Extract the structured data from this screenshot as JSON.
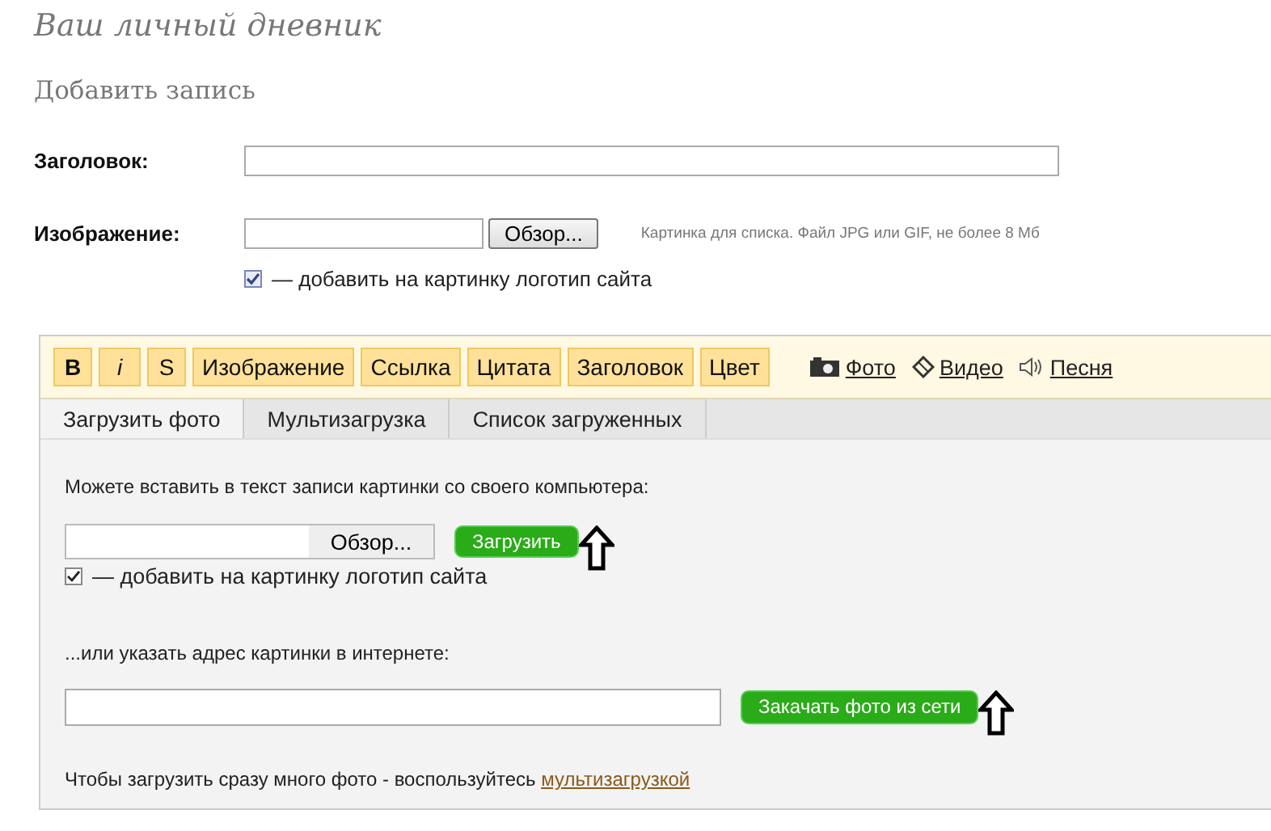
{
  "page_title": "Ваш личный дневник",
  "section_title": "Добавить запись",
  "form": {
    "title_label": "Заголовок:",
    "image_label": "Изображение:",
    "browse_button": "Обзор...",
    "image_hint": "Картинка для списка. Файл JPG или GIF, не более 8 Мб",
    "logo_checkbox": {
      "label": "— добавить на картинку логотип сайта",
      "checked": true
    }
  },
  "editor": {
    "format_buttons": [
      {
        "label": "B",
        "kind": "bold"
      },
      {
        "label": "i",
        "kind": "italic"
      },
      {
        "label": "S",
        "kind": "plain"
      },
      {
        "label": "Изображение",
        "kind": "plain"
      },
      {
        "label": "Ссылка",
        "kind": "plain"
      },
      {
        "label": "Цитата",
        "kind": "plain"
      },
      {
        "label": "Заголовок",
        "kind": "plain"
      },
      {
        "label": "Цвет",
        "kind": "plain"
      }
    ],
    "media_links": [
      {
        "label": "Фото"
      },
      {
        "label": "Видео"
      },
      {
        "label": "Песня"
      }
    ],
    "tabs": [
      {
        "label": "Загрузить фото",
        "selected": true
      },
      {
        "label": "Мультизагрузка",
        "selected": false
      },
      {
        "label": "Список загруженных",
        "selected": false
      }
    ],
    "upload": {
      "intro": "Можете вставить в текст записи картинки со своего компьютера:",
      "browse_button": "Обзор...",
      "upload_button": "Загрузить",
      "logo_checkbox": {
        "label": "— добавить на картинку логотип сайта",
        "checked": true
      },
      "url_label": "...или указать адрес картинки в интернете:",
      "fetch_button": "Закачать фото из сети",
      "footer_text": "Чтобы загрузить сразу много фото - воспользуйтесь ",
      "footer_link": "мультизагрузкой"
    }
  }
}
